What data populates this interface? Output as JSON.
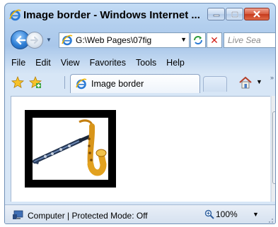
{
  "window": {
    "title": "Image border - Windows Internet ..."
  },
  "nav": {
    "address": "G:\\Web Pages\\07fig",
    "search_placeholder": "Live Sea"
  },
  "menu": {
    "items": [
      "File",
      "Edit",
      "View",
      "Favorites",
      "Tools",
      "Help"
    ]
  },
  "tabs": {
    "active_label": "Image border"
  },
  "content": {
    "image_description_icons": [
      "clarinet-icon",
      "saxophone-icon"
    ]
  },
  "status": {
    "zone_text": "Computer | Protected Mode: Off",
    "zoom": "100%"
  },
  "colors": {
    "chrome_blue": "#b3cfee",
    "close_red": "#c63a1c",
    "image_border": "#000000"
  }
}
